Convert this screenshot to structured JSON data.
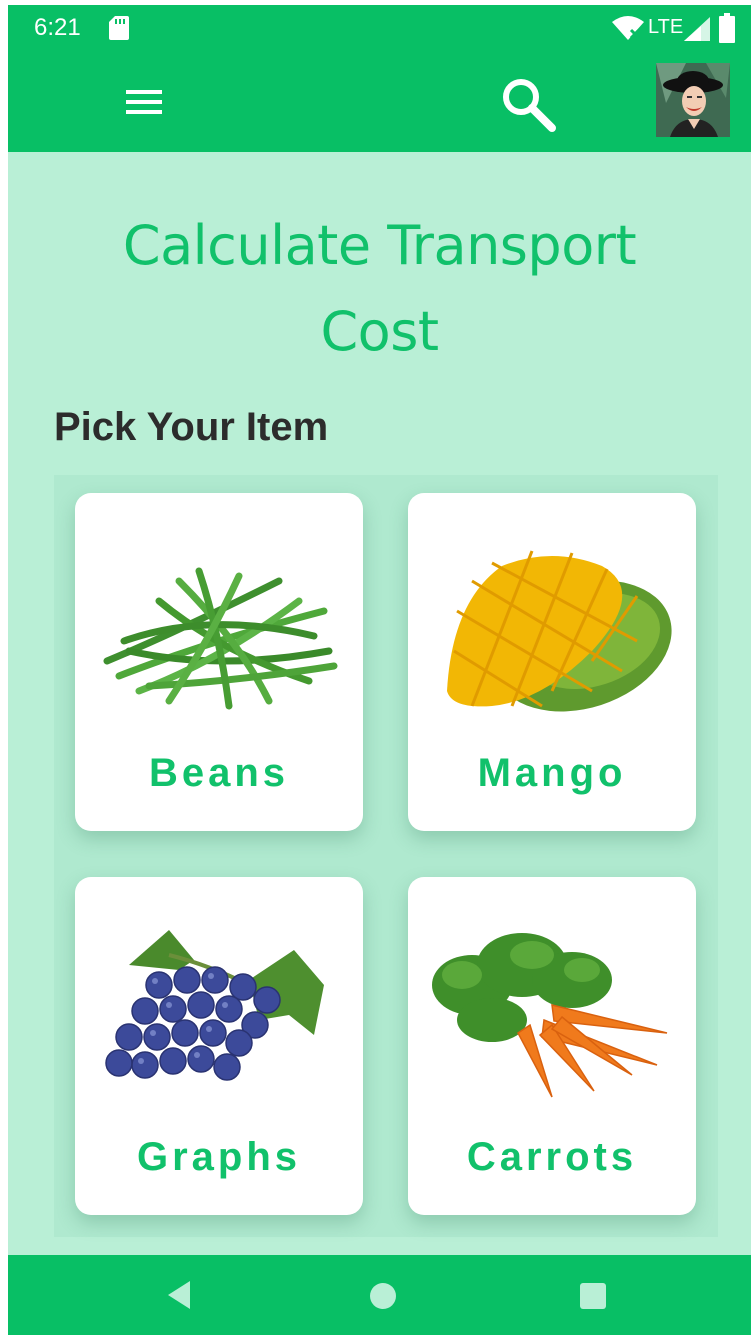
{
  "status_bar": {
    "time": "6:21",
    "network": "LTE"
  },
  "app_bar": {
    "menu_icon": "hamburger-menu-icon",
    "search_icon": "search-icon",
    "avatar": "user-avatar"
  },
  "page": {
    "title_line1": "Calculate Transport",
    "title_line2": "Cost",
    "subtitle": "Pick Your Item"
  },
  "items": [
    {
      "label": "Beans",
      "icon": "green-beans-image"
    },
    {
      "label": "Mango",
      "icon": "mango-image"
    },
    {
      "label": "Graphs",
      "icon": "grapes-image"
    },
    {
      "label": "Carrots",
      "icon": "carrots-image"
    }
  ],
  "colors": {
    "primary": "#08bf65",
    "accent_text": "#11c16b",
    "background": "#b9efd6",
    "card": "#ffffff"
  },
  "nav_bar": {
    "back_icon": "back-triangle-icon",
    "home_icon": "home-circle-icon",
    "recents_icon": "recents-square-icon"
  }
}
